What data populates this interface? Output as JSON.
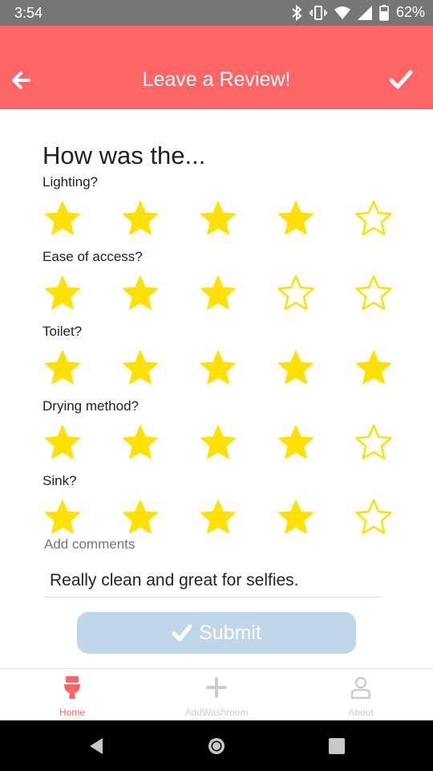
{
  "status_bar": {
    "time": "3:54",
    "battery": "62%"
  },
  "header": {
    "title": "Leave a Review!",
    "back_icon": "arrow-left-icon",
    "confirm_icon": "checkmark-icon"
  },
  "form": {
    "heading": "How was the...",
    "categories": [
      {
        "label": "Lighting?",
        "rating": 4,
        "max": 5
      },
      {
        "label": "Ease of access?",
        "rating": 3,
        "max": 5
      },
      {
        "label": "Toilet?",
        "rating": 5,
        "max": 5
      },
      {
        "label": "Drying method?",
        "rating": 4,
        "max": 5
      },
      {
        "label": "Sink?",
        "rating": 4,
        "max": 5
      }
    ],
    "comments_label": "Add comments",
    "comments_value": "Really clean and great for selfies.",
    "submit_label": "Submit"
  },
  "tabs": [
    {
      "label": "Home",
      "icon": "toilet-icon",
      "active": true
    },
    {
      "label": "AddWashroom",
      "icon": "plus-icon",
      "active": false
    },
    {
      "label": "About",
      "icon": "person-icon",
      "active": false
    }
  ],
  "colors": {
    "header": "#ff6565",
    "star": "#ffe100",
    "submit": "#c0d6ea",
    "tab_active": "#ff6565",
    "tab_inactive": "#cccccc"
  }
}
